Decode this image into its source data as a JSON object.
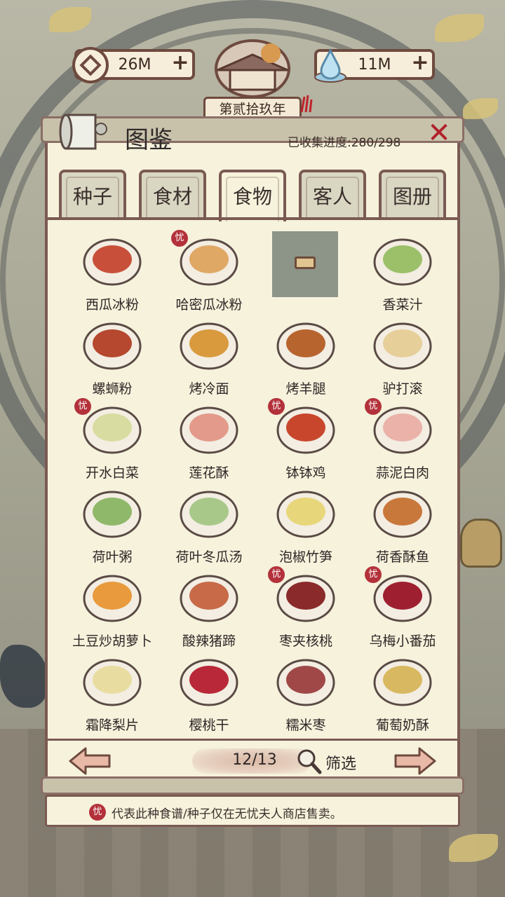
{
  "currency": {
    "coins": {
      "value": "26M",
      "icon": "coin-icon"
    },
    "spirit": {
      "value": "11M",
      "icon": "water-drop-icon"
    },
    "plus_label": "+"
  },
  "year_banner": "第贰拾玖年",
  "panel": {
    "title": "图鉴",
    "progress": "已收集进度:280/298",
    "close_label": "✕"
  },
  "tabs": [
    {
      "label": "种子",
      "active": false
    },
    {
      "label": "食材",
      "active": false
    },
    {
      "label": "食物",
      "active": true
    },
    {
      "label": "客人",
      "active": false
    },
    {
      "label": "图册",
      "active": false
    }
  ],
  "badge_label": "忧",
  "items": [
    {
      "name": "西瓜冰粉",
      "badge": false,
      "locked": false,
      "color": "#c8503a"
    },
    {
      "name": "哈密瓜冰粉",
      "badge": true,
      "locked": false,
      "color": "#e0a865"
    },
    {
      "name": "",
      "badge": false,
      "locked": true,
      "color": "#8d9488"
    },
    {
      "name": "香菜汁",
      "badge": false,
      "locked": false,
      "color": "#9cc06a"
    },
    {
      "name": "螺蛳粉",
      "badge": false,
      "locked": false,
      "color": "#b5482e"
    },
    {
      "name": "烤冷面",
      "badge": false,
      "locked": false,
      "color": "#d99a3e"
    },
    {
      "name": "烤羊腿",
      "badge": false,
      "locked": false,
      "color": "#b8642e"
    },
    {
      "name": "驴打滚",
      "badge": false,
      "locked": false,
      "color": "#e6cf98"
    },
    {
      "name": "开水白菜",
      "badge": true,
      "locked": false,
      "color": "#d8dca0"
    },
    {
      "name": "莲花酥",
      "badge": false,
      "locked": false,
      "color": "#e39a8a"
    },
    {
      "name": "钵钵鸡",
      "badge": true,
      "locked": false,
      "color": "#c8462c"
    },
    {
      "name": "蒜泥白肉",
      "badge": true,
      "locked": false,
      "color": "#eab2a8"
    },
    {
      "name": "荷叶粥",
      "badge": false,
      "locked": false,
      "color": "#8fb86a"
    },
    {
      "name": "荷叶冬瓜汤",
      "badge": false,
      "locked": false,
      "color": "#a8c88a"
    },
    {
      "name": "泡椒竹笋",
      "badge": false,
      "locked": false,
      "color": "#e8d67a"
    },
    {
      "name": "荷香酥鱼",
      "badge": false,
      "locked": false,
      "color": "#c9783c"
    },
    {
      "name": "土豆炒胡萝卜",
      "badge": false,
      "locked": false,
      "color": "#e89a3c"
    },
    {
      "name": "酸辣猪蹄",
      "badge": false,
      "locked": false,
      "color": "#c86a48"
    },
    {
      "name": "枣夹核桃",
      "badge": true,
      "locked": false,
      "color": "#8a2a2a"
    },
    {
      "name": "乌梅小番茄",
      "badge": true,
      "locked": false,
      "color": "#9e2030"
    },
    {
      "name": "霜降梨片",
      "badge": false,
      "locked": false,
      "color": "#e8dca0"
    },
    {
      "name": "樱桃干",
      "badge": false,
      "locked": false,
      "color": "#b82838"
    },
    {
      "name": "糯米枣",
      "badge": false,
      "locked": false,
      "color": "#a04848"
    },
    {
      "name": "葡萄奶酥",
      "badge": false,
      "locked": false,
      "color": "#d8b860"
    }
  ],
  "pager": {
    "page": "12/13",
    "filter_label": "筛选",
    "prev_icon": "arrow-left-icon",
    "next_icon": "arrow-right-icon"
  },
  "note": {
    "text": "代表此种食谱/种子仅在无忧夫人商店售卖。"
  }
}
